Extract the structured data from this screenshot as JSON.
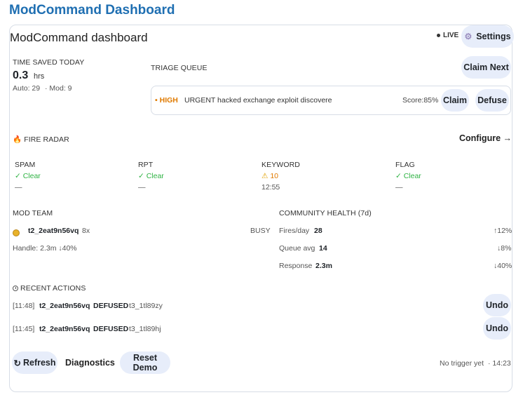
{
  "app": {
    "title": "ModCommand Dashboard"
  },
  "panel": {
    "title": "ModCommand dashboard",
    "live_label": "LIVE",
    "settings_label": "Settings"
  },
  "time_saved": {
    "heading": "TIME SAVED TODAY",
    "value": "0.3",
    "unit": "hrs",
    "auto": "Auto: 29",
    "mod": "· Mod: 9"
  },
  "triage": {
    "heading": "TRIAGE QUEUE",
    "claim_next_label": "Claim Next",
    "items": [
      {
        "priority": "HIGH",
        "title": "URGENT hacked exchange exploit discovere",
        "score": "Score:85%",
        "claim_label": "Claim",
        "defuse_label": "Defuse"
      }
    ]
  },
  "fire_radar": {
    "heading": "FIRE RADAR",
    "configure_label": "Configure →",
    "metrics": [
      {
        "label": "SPAM",
        "status": "✓ Clear",
        "detail": "—"
      },
      {
        "label": "RPT",
        "status": "✓ Clear",
        "detail": "—"
      },
      {
        "label": "KEYWORD",
        "status": "10",
        "detail": "12:55"
      },
      {
        "label": "FLAG",
        "status": "✓ Clear",
        "detail": "—"
      }
    ]
  },
  "mod_team": {
    "heading": "MOD TEAM",
    "members": [
      {
        "name": "t2_2eat9n56vq",
        "count": "8x",
        "status": "BUSY"
      }
    ],
    "handle": "Handle: 2.3m ↓40%"
  },
  "community_health": {
    "heading": "COMMUNITY HEALTH (7d)",
    "rows": [
      {
        "label": "Fires/day",
        "value": "28",
        "delta": "↑12%"
      },
      {
        "label": "Queue avg",
        "value": "14",
        "delta": "↓8%"
      },
      {
        "label": "Response",
        "value": "2.3m",
        "delta": "↓40%"
      }
    ]
  },
  "recent_actions": {
    "heading": "RECENT ACTIONS",
    "items": [
      {
        "time": "[11:48]",
        "user": "t2_2eat9n56vq",
        "action": "DEFUSED",
        "target": "t3_1tl89zy",
        "undo_label": "Undo"
      },
      {
        "time": "[11:45]",
        "user": "t2_2eat9n56vq",
        "action": "DEFUSED",
        "target": "t3_1tl89hj",
        "undo_label": "Undo"
      }
    ]
  },
  "footer": {
    "refresh_label": "Refresh",
    "diagnostics_label": "Diagnostics",
    "reset_label": "Reset Demo",
    "trigger_status": "No trigger yet",
    "time": "· 14:23"
  },
  "colors": {
    "accent": "#1f6fb2",
    "pill": "#e7edfa",
    "ok": "#2fb344",
    "warn": "#e07b00"
  }
}
